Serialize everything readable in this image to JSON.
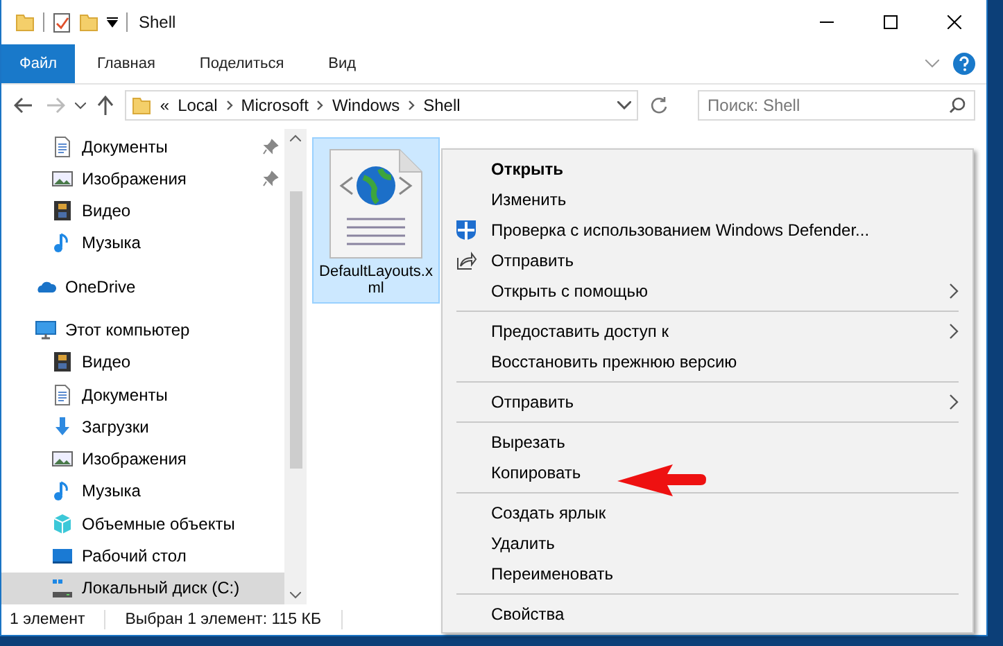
{
  "window": {
    "title": "Shell"
  },
  "ribbon_tabs": [
    {
      "label": "Файл",
      "selected": true
    },
    {
      "label": "Главная",
      "selected": false
    },
    {
      "label": "Поделиться",
      "selected": false
    },
    {
      "label": "Вид",
      "selected": false
    }
  ],
  "address_bar": {
    "overflow": "«",
    "crumbs": [
      "Local",
      "Microsoft",
      "Windows",
      "Shell"
    ]
  },
  "search": {
    "placeholder": "Поиск: Shell"
  },
  "sidebar": {
    "quick_access": [
      {
        "label": "Документы",
        "kind": "document",
        "pinned": true,
        "selected": false
      },
      {
        "label": "Изображения",
        "kind": "image",
        "pinned": true,
        "selected": false
      },
      {
        "label": "Видео",
        "kind": "video",
        "pinned": false,
        "selected": false
      },
      {
        "label": "Музыка",
        "kind": "music",
        "pinned": false,
        "selected": false
      }
    ],
    "items": [
      {
        "label": "OneDrive",
        "kind": "cloud",
        "pinned": false,
        "selected": false
      },
      {
        "label": "Этот компьютер",
        "kind": "computer",
        "pinned": false,
        "selected": false,
        "children": [
          {
            "label": "Видео",
            "kind": "video",
            "pinned": false,
            "selected": false
          },
          {
            "label": "Документы",
            "kind": "document",
            "pinned": false,
            "selected": false
          },
          {
            "label": "Загрузки",
            "kind": "download",
            "pinned": false,
            "selected": false
          },
          {
            "label": "Изображения",
            "kind": "image",
            "pinned": false,
            "selected": false
          },
          {
            "label": "Музыка",
            "kind": "music",
            "pinned": false,
            "selected": false
          },
          {
            "label": "Объемные объекты",
            "kind": "cube",
            "pinned": false,
            "selected": false
          },
          {
            "label": "Рабочий стол",
            "kind": "desktop",
            "pinned": false,
            "selected": false
          },
          {
            "label": "Локальный диск (C:)",
            "kind": "drive",
            "pinned": false,
            "selected": true
          }
        ]
      }
    ]
  },
  "files": [
    {
      "name": "DefaultLayouts.xml",
      "selected": true
    }
  ],
  "context_menu": {
    "groups": [
      [
        {
          "label": "Открыть",
          "default": true,
          "kind": "plain",
          "submenu": false
        },
        {
          "label": "Изменить",
          "default": false,
          "kind": "plain",
          "submenu": false
        },
        {
          "label": "Проверка с использованием Windows Defender...",
          "default": false,
          "kind": "scan",
          "submenu": false
        },
        {
          "label": "Отправить",
          "default": false,
          "kind": "share",
          "submenu": false
        },
        {
          "label": "Открыть с помощью",
          "default": false,
          "kind": "plain",
          "submenu": true
        }
      ],
      [
        {
          "label": "Предоставить доступ к",
          "default": false,
          "kind": "plain",
          "submenu": true
        },
        {
          "label": "Восстановить прежнюю версию",
          "default": false,
          "kind": "plain",
          "submenu": false
        }
      ],
      [
        {
          "label": "Отправить",
          "default": false,
          "kind": "plain",
          "submenu": true
        }
      ],
      [
        {
          "label": "Вырезать",
          "default": false,
          "kind": "plain",
          "submenu": false
        },
        {
          "label": "Копировать",
          "default": false,
          "kind": "plain",
          "submenu": false
        }
      ],
      [
        {
          "label": "Создать ярлык",
          "default": false,
          "kind": "plain",
          "submenu": false
        },
        {
          "label": "Удалить",
          "default": false,
          "kind": "plain",
          "submenu": false
        },
        {
          "label": "Переименовать",
          "default": false,
          "kind": "plain",
          "submenu": false
        }
      ],
      [
        {
          "label": "Свойства",
          "default": false,
          "kind": "plain",
          "submenu": false
        }
      ]
    ]
  },
  "status_bar": {
    "count": "1 элемент",
    "selection": "Выбран 1 элемент: 115 КБ"
  }
}
